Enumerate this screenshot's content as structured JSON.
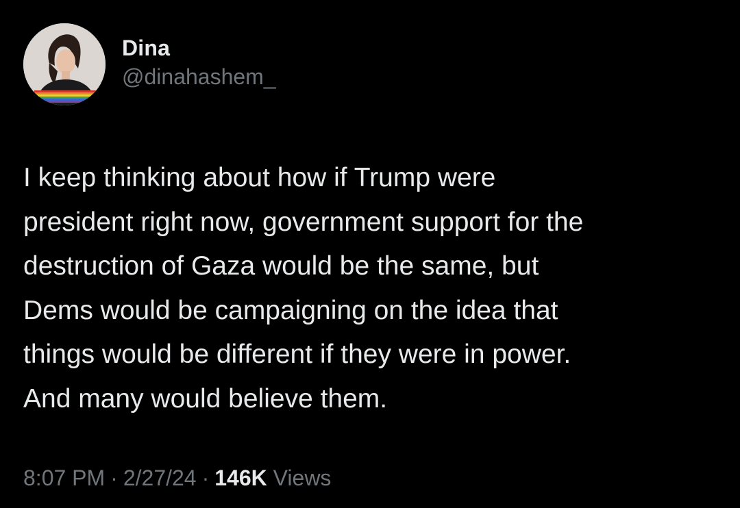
{
  "author": {
    "display_name": "Dina",
    "handle": "@dinahashem_",
    "avatar_icon": "profile-photo-avatar"
  },
  "tweet": {
    "lines": [
      "I keep thinking about how if Trump were",
      "president right now, government support for the",
      "destruction of Gaza would be the same, but",
      "Dems would be campaigning on the idea that",
      "things would be different if they were in power.",
      "And many would believe them."
    ]
  },
  "meta": {
    "time": "8:07 PM",
    "date": "2/27/24",
    "separator": "·",
    "views_count": "146K",
    "views_label": "Views"
  },
  "colors": {
    "background": "#000000",
    "primary_text": "#e7e9ea",
    "secondary_text": "#71767b"
  }
}
